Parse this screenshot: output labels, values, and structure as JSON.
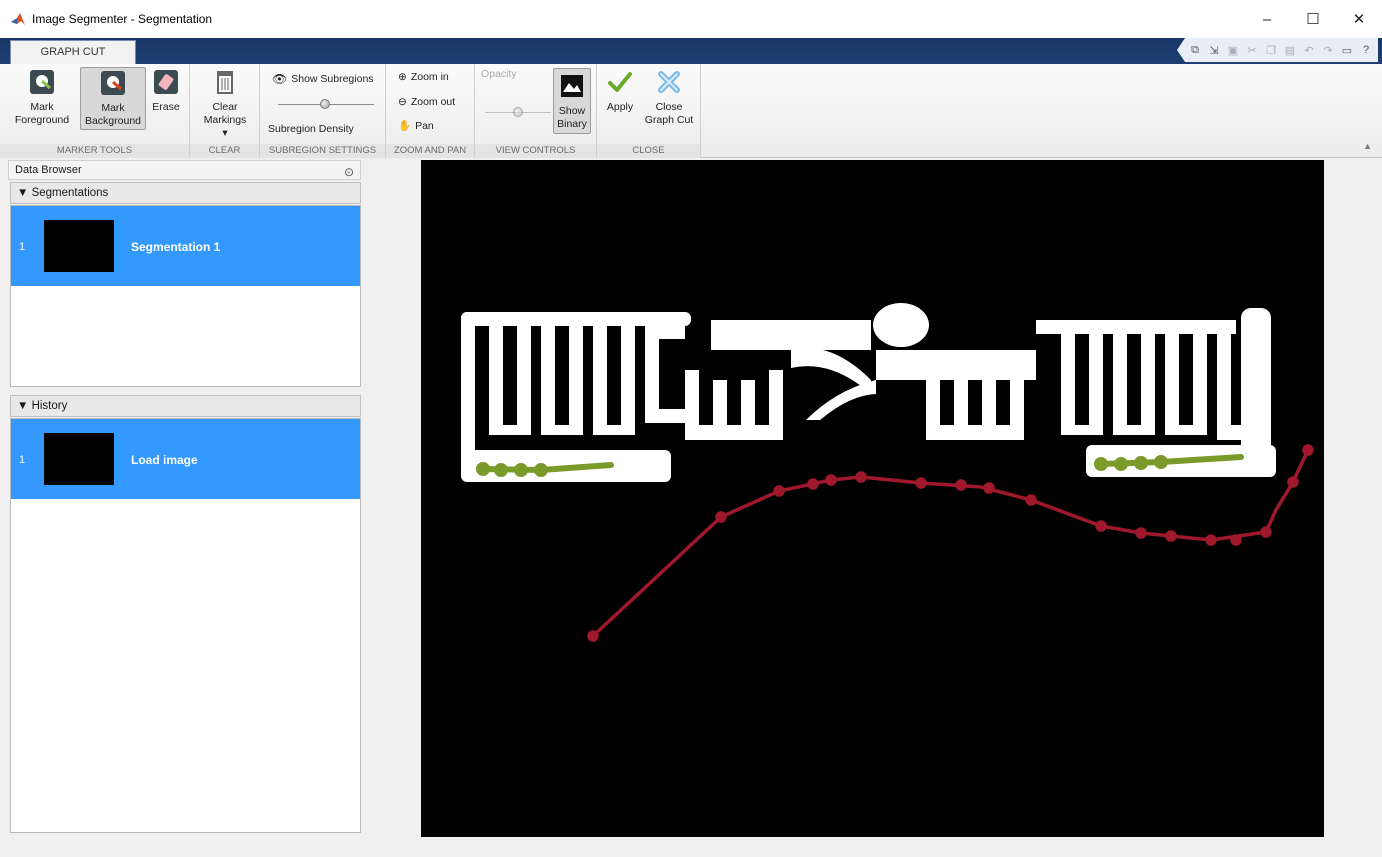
{
  "window": {
    "title": "Image Segmenter - Segmentation",
    "controls": [
      "–",
      "☐",
      "✕"
    ]
  },
  "tabs": [
    {
      "label": "GRAPH CUT",
      "selected": true
    }
  ],
  "ribbon": {
    "marker_tools": {
      "section_label": "MARKER TOOLS",
      "mark_foreground": "Mark Foreground",
      "mark_background": "Mark Background",
      "erase": "Erase"
    },
    "clear": {
      "section_label": "CLEAR",
      "clear_markings": "Clear Markings ▾"
    },
    "subregion_settings": {
      "section_label": "SUBREGION SETTINGS",
      "show_subregions": "Show Subregions",
      "subregion_density": "Subregion Density"
    },
    "zoom_and_pan": {
      "section_label": "ZOOM AND PAN",
      "zoom_in": "Zoom in",
      "zoom_out": "Zoom out",
      "pan": "Pan"
    },
    "view_controls": {
      "section_label": "VIEW CONTROLS",
      "opacity": "Opacity",
      "show_binary": "Show Binary"
    },
    "close": {
      "section_label": "CLOSE",
      "apply": "Apply",
      "close_graph_cut": "Close Graph Cut"
    }
  },
  "data_browser": {
    "title": "Data Browser",
    "segmentations": {
      "header": "▼ Segmentations",
      "items": [
        {
          "index": "1",
          "name": "Segmentation 1"
        }
      ]
    },
    "history": {
      "header": "▼ History",
      "items": [
        {
          "index": "1",
          "name": "Load image"
        }
      ]
    }
  },
  "colors": {
    "selection": "#3399ff",
    "tabstrip": "#1b3a6b",
    "foreground_marker": "#7a9a2a",
    "background_marker": "#a0182c"
  }
}
